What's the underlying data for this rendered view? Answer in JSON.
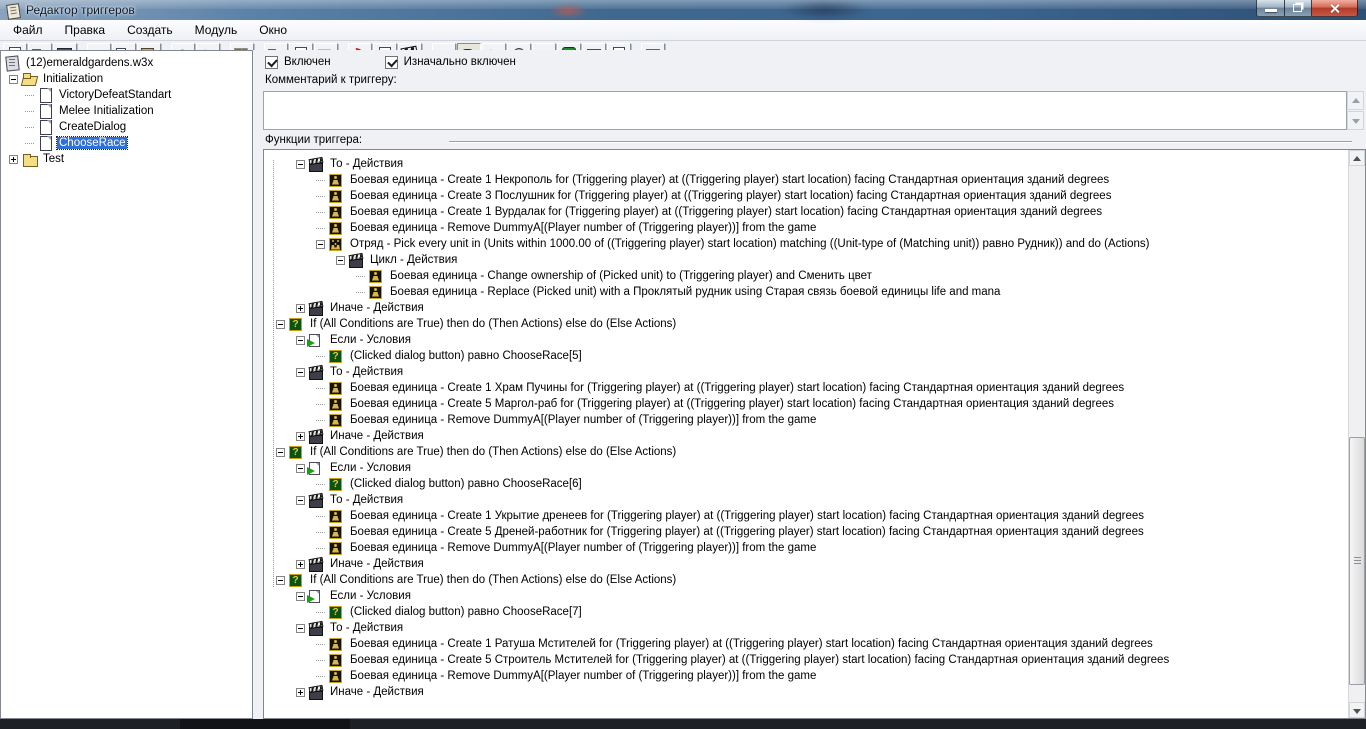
{
  "window": {
    "title": "Редактор триггеров",
    "colors": {
      "titlebar_blue": "#40688f",
      "close_red": "#b03a28",
      "selection_blue": "#2f6fd8",
      "unit_icon_gold": "#ddb93a",
      "condition_green": "#0b5410"
    }
  },
  "menu": {
    "items": [
      {
        "name": "menu-file",
        "label": "Файл"
      },
      {
        "name": "menu-edit",
        "label": "Правка"
      },
      {
        "name": "menu-create",
        "label": "Создать"
      },
      {
        "name": "menu-module",
        "label": "Модуль"
      },
      {
        "name": "menu-window",
        "label": "Окно"
      }
    ]
  },
  "toolbar": {
    "buttons": [
      {
        "name": "new-map-button",
        "icon": "new-doc"
      },
      {
        "name": "open-map-button",
        "icon": "open-folder"
      },
      {
        "name": "save-map-button",
        "icon": "floppy"
      },
      {
        "name": "cut-button",
        "icon": "scissors",
        "gap": true
      },
      {
        "name": "copy-button",
        "icon": "copy"
      },
      {
        "name": "paste-button",
        "icon": "paste"
      },
      {
        "name": "undo-button",
        "icon": "undo",
        "gap": true
      },
      {
        "name": "redo-button",
        "icon": "redo",
        "state": "disabled"
      },
      {
        "name": "delete-button",
        "icon": "gold-x",
        "gap": true
      },
      {
        "name": "new-category-button",
        "icon": "folder",
        "gap": true
      },
      {
        "name": "new-trigger-button",
        "icon": "new-doc"
      },
      {
        "name": "new-comment-button",
        "icon": "comment-lines"
      },
      {
        "name": "new-event-button",
        "icon": "red-flag",
        "gap": true
      },
      {
        "name": "new-condition-button",
        "icon": "page-green-arrow"
      },
      {
        "name": "new-action-button",
        "icon": "clapperboard"
      },
      {
        "name": "terrain-editor-button",
        "icon": "mountain",
        "gap": true
      },
      {
        "name": "trigger-editor-button",
        "icon": "letter-a",
        "state": "pressed"
      },
      {
        "name": "sound-editor-button",
        "icon": "speaker"
      },
      {
        "name": "object-editor-button",
        "icon": "jellyfish"
      },
      {
        "name": "campaign-editor-button",
        "icon": "bench"
      },
      {
        "name": "ai-editor-button",
        "icon": "green-face"
      },
      {
        "name": "object-manager-button",
        "icon": "cube"
      },
      {
        "name": "import-manager-button",
        "icon": "page-green-arrow"
      },
      {
        "name": "check-map-button",
        "icon": "checkbox-red-check",
        "gap": true
      }
    ]
  },
  "trigger_tree": {
    "rows": [
      {
        "name": "map-root-item",
        "level": 0,
        "root": true,
        "icon": "map",
        "text": "(12)emeraldgardens.w3x"
      },
      {
        "name": "category-initialization",
        "level": 0,
        "expand": "minus",
        "icon": "folder-open",
        "text": "Initialization"
      },
      {
        "name": "trigger-victorydefeatstandart",
        "level": 1,
        "icon": "page",
        "text": "VictoryDefeatStandart"
      },
      {
        "name": "trigger-melee-initialization",
        "level": 1,
        "icon": "page",
        "text": "Melee Initialization"
      },
      {
        "name": "trigger-createdialog",
        "level": 1,
        "icon": "page",
        "text": "CreateDialog"
      },
      {
        "name": "trigger-chooserace",
        "level": 1,
        "icon": "page",
        "text": "ChooseRace",
        "selected": true
      },
      {
        "name": "category-test",
        "level": 0,
        "expand": "plus",
        "icon": "folder",
        "text": "Test"
      }
    ]
  },
  "properties": {
    "enabled_checkbox": {
      "label": "Включен",
      "checked": true
    },
    "initially_on_checkbox": {
      "label": "Изначально включен",
      "checked": true
    },
    "comment_label": "Комментарий к триггеру:",
    "comment_value": "",
    "functions_label": "Функции триггера:"
  },
  "functions_tree": {
    "rows": [
      {
        "level": 1,
        "expand": "minus",
        "icon": "actions",
        "text": "То - Действия"
      },
      {
        "level": 2,
        "icon": "unit",
        "text": "Боевая единица - Create 1 Некрополь for (Triggering player) at ((Triggering player) start location) facing Стандартная ориентация зданий degrees"
      },
      {
        "level": 2,
        "icon": "unit",
        "text": "Боевая единица - Create 3 Послушник for (Triggering player) at ((Triggering player) start location) facing Стандартная ориентация зданий degrees"
      },
      {
        "level": 2,
        "icon": "unit",
        "text": "Боевая единица - Create 1 Вурдалак for (Triggering player) at ((Triggering player) start location) facing Стандартная ориентация зданий degrees"
      },
      {
        "level": 2,
        "icon": "unit",
        "text": "Боевая единица - Remove DummyA[(Player number of (Triggering player))] from the game"
      },
      {
        "level": 2,
        "expand": "minus",
        "icon": "group",
        "text": "Отряд - Pick every unit in (Units within 1000.00 of ((Triggering player) start location) matching ((Unit-type of (Matching unit)) равно Рудник)) and do (Actions)"
      },
      {
        "level": 3,
        "expand": "minus",
        "icon": "actions",
        "text": "Цикл - Действия"
      },
      {
        "level": 4,
        "icon": "unit",
        "text": "Боевая единица - Change ownership of (Picked unit) to (Triggering player) and Сменить цвет"
      },
      {
        "level": 4,
        "icon": "unit",
        "text": "Боевая единица - Replace (Picked unit) with a Проклятый рудник using Старая связь боевой единицы life and mana"
      },
      {
        "level": 1,
        "expand": "plus",
        "icon": "actions",
        "text": "Иначе - Действия"
      },
      {
        "level": 0,
        "expand": "minus",
        "icon": "if",
        "text": "If (All Conditions are True) then do (Then Actions) else do (Else Actions)"
      },
      {
        "level": 1,
        "expand": "minus",
        "icon": "cond",
        "text": "Если - Условия"
      },
      {
        "level": 2,
        "icon": "if",
        "text": "(Clicked dialog button) равно ChooseRace[5]"
      },
      {
        "level": 1,
        "expand": "minus",
        "icon": "actions",
        "text": "То - Действия"
      },
      {
        "level": 2,
        "icon": "unit",
        "text": "Боевая единица - Create 1 Храм Пучины for (Triggering player) at ((Triggering player) start location) facing Стандартная ориентация зданий degrees"
      },
      {
        "level": 2,
        "icon": "unit",
        "text": "Боевая единица - Create 5 Маргол-раб for (Triggering player) at ((Triggering player) start location) facing Стандартная ориентация зданий degrees"
      },
      {
        "level": 2,
        "icon": "unit",
        "text": "Боевая единица - Remove DummyA[(Player number of (Triggering player))] from the game"
      },
      {
        "level": 1,
        "expand": "plus",
        "icon": "actions",
        "text": "Иначе - Действия"
      },
      {
        "level": 0,
        "expand": "minus",
        "icon": "if",
        "text": "If (All Conditions are True) then do (Then Actions) else do (Else Actions)"
      },
      {
        "level": 1,
        "expand": "minus",
        "icon": "cond",
        "text": "Если - Условия"
      },
      {
        "level": 2,
        "icon": "if",
        "text": "(Clicked dialog button) равно ChooseRace[6]"
      },
      {
        "level": 1,
        "expand": "minus",
        "icon": "actions",
        "text": "То - Действия"
      },
      {
        "level": 2,
        "icon": "unit",
        "text": "Боевая единица - Create 1 Укрытие дренеев for (Triggering player) at ((Triggering player) start location) facing Стандартная ориентация зданий degrees"
      },
      {
        "level": 2,
        "icon": "unit",
        "text": "Боевая единица - Create 5 Дреней-работник for (Triggering player) at ((Triggering player) start location) facing Стандартная ориентация зданий degrees"
      },
      {
        "level": 2,
        "icon": "unit",
        "text": "Боевая единица - Remove DummyA[(Player number of (Triggering player))] from the game"
      },
      {
        "level": 1,
        "expand": "plus",
        "icon": "actions",
        "text": "Иначе - Действия"
      },
      {
        "level": 0,
        "expand": "minus",
        "icon": "if",
        "text": "If (All Conditions are True) then do (Then Actions) else do (Else Actions)"
      },
      {
        "level": 1,
        "expand": "minus",
        "icon": "cond",
        "text": "Если - Условия"
      },
      {
        "level": 2,
        "icon": "if",
        "text": "(Clicked dialog button) равно ChooseRace[7]"
      },
      {
        "level": 1,
        "expand": "minus",
        "icon": "actions",
        "text": "То - Действия"
      },
      {
        "level": 2,
        "icon": "unit",
        "text": "Боевая единица - Create 1 Ратуша Мстителей for (Triggering player) at ((Triggering player) start location) facing Стандартная ориентация зданий degrees"
      },
      {
        "level": 2,
        "icon": "unit",
        "text": "Боевая единица - Create 5 Строитель Мстителей for (Triggering player) at ((Triggering player) start location) facing Стандартная ориентация зданий degrees"
      },
      {
        "level": 2,
        "icon": "unit",
        "text": "Боевая единица - Remove DummyA[(Player number of (Triggering player))] from the game"
      },
      {
        "level": 1,
        "expand": "plus",
        "icon": "actions",
        "text": "Иначе - Действия"
      }
    ]
  }
}
